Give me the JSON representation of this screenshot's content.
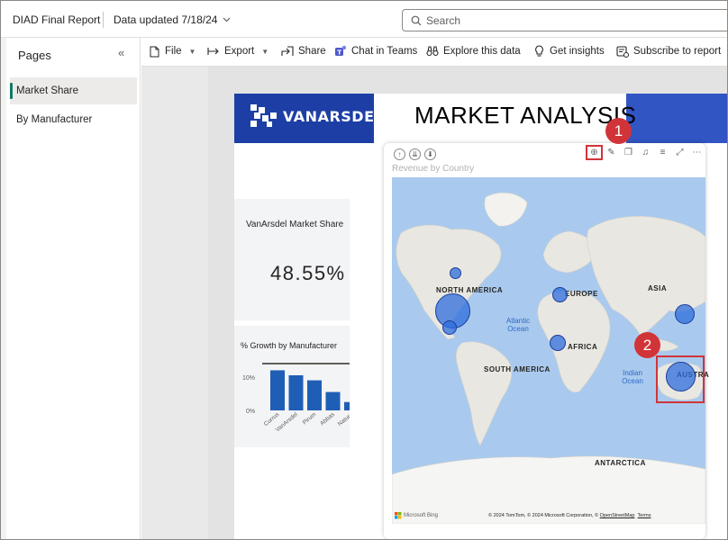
{
  "header": {
    "app_title": "DIAD Final Report",
    "data_updated": "Data updated 7/18/24",
    "search_placeholder": "Search"
  },
  "pages_pane": {
    "title": "Pages",
    "collapse_icon": "«",
    "items": [
      {
        "label": "Market Share",
        "active": true
      },
      {
        "label": "By Manufacturer",
        "active": false
      }
    ]
  },
  "toolbar": {
    "file": "File",
    "export": "Export",
    "share": "Share",
    "chat": "Chat in Teams",
    "explore": "Explore this data",
    "insights": "Get insights",
    "subscribe": "Subscribe to report"
  },
  "report": {
    "logo_text": "VANARSDEL",
    "title": "MARKET ANALYSIS",
    "kpi": {
      "label": "VanArsdel Market Share",
      "value": "48.55%"
    },
    "growth": {
      "title": "% Growth by Manufacturer",
      "y_ticks": [
        "10%",
        "0%"
      ]
    },
    "map": {
      "title": "Revenue by Country",
      "labels": {
        "north_america": "NORTH AMERICA",
        "south_america": "SOUTH AMERICA",
        "europe": "EUROPE",
        "africa": "AFRICA",
        "asia": "ASIA",
        "australia": "AUSTRA",
        "antarctica": "ANTARCTICA",
        "atlantic": "Atlantic Ocean",
        "indian": "Indian Ocean"
      },
      "footer": "© 2024 TomTom, © 2024 Microsoft Corporation, ©",
      "footer_link1": "OpenStreetMap",
      "footer_link2": "Terms",
      "bing": "Microsoft Bing"
    }
  },
  "annotations": [
    "1",
    "2"
  ],
  "colors": {
    "accent": "#3155c3",
    "bar": "#1f5eb5",
    "annotation": "#d13438",
    "active_page": "#117865"
  },
  "chart_data": {
    "type": "bar",
    "title": "% Growth by Manufacturer",
    "categories": [
      "Currus",
      "VanArsdel",
      "Pirum",
      "Abbas",
      "Natura"
    ],
    "values": [
      12,
      10.5,
      9,
      5.5,
      2.5
    ],
    "ylim": [
      0,
      14
    ],
    "y_ticks": [
      "10%",
      "0%"
    ]
  }
}
